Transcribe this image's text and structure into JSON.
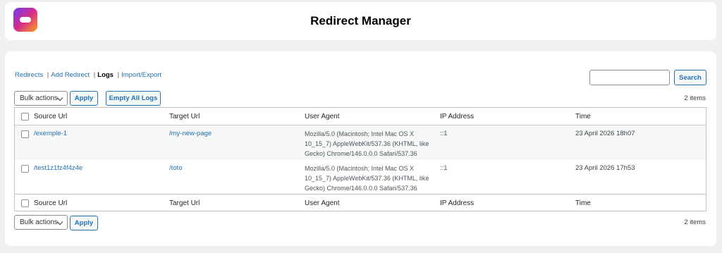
{
  "app": {
    "title": "Redirect Manager"
  },
  "subnav": {
    "redirects": "Redirects",
    "add_redirect": "Add Redirect",
    "logs": "Logs",
    "import_export": "Import/Export",
    "separator": "|"
  },
  "search": {
    "button_label": "Search",
    "value": ""
  },
  "top_bulk": {
    "select_value": "Bulk actions",
    "apply_label": "Apply",
    "empty_logs_label": "Empty All Logs",
    "count": "2 items"
  },
  "bottom_bulk": {
    "select_value": "Bulk actions",
    "apply_label": "Apply",
    "count": "2 items"
  },
  "table": {
    "columns": [
      "Source Url",
      "Target Url",
      "User Agent",
      "IP Address",
      "Time"
    ],
    "rows": [
      {
        "source": "/exemple-1",
        "target": "/my-new-page",
        "ua_line1": "Mozilla/5.0 (Macintosh; Intel Mac OS X",
        "ua_line2": "10_15_7) AppleWebKit/537.36 (KHTML, like",
        "ua_line3": "Gecko) Chrome/146.0.0.0 Safari/537.36",
        "ip": "::1",
        "time": "23 April 2026 18h07"
      },
      {
        "source": "/test1z1fz4f4z4e",
        "target": "/toto",
        "ua_line1": "Mozilla/5.0 (Macintosh; Intel Mac OS X",
        "ua_line2": "10_15_7) AppleWebKit/537.36 (KHTML, like",
        "ua_line3": "Gecko) Chrome/146.0.0.0 Safari/537.36",
        "ip": "::1",
        "time": "23 April 2026 17h53"
      }
    ]
  },
  "colors": {
    "accent": "#2271b1",
    "background": "#f0f0f1",
    "border": "#c3c4c7"
  },
  "icons": {
    "logo": "app-logo-icon",
    "dropdown": "chevron-down-icon"
  }
}
